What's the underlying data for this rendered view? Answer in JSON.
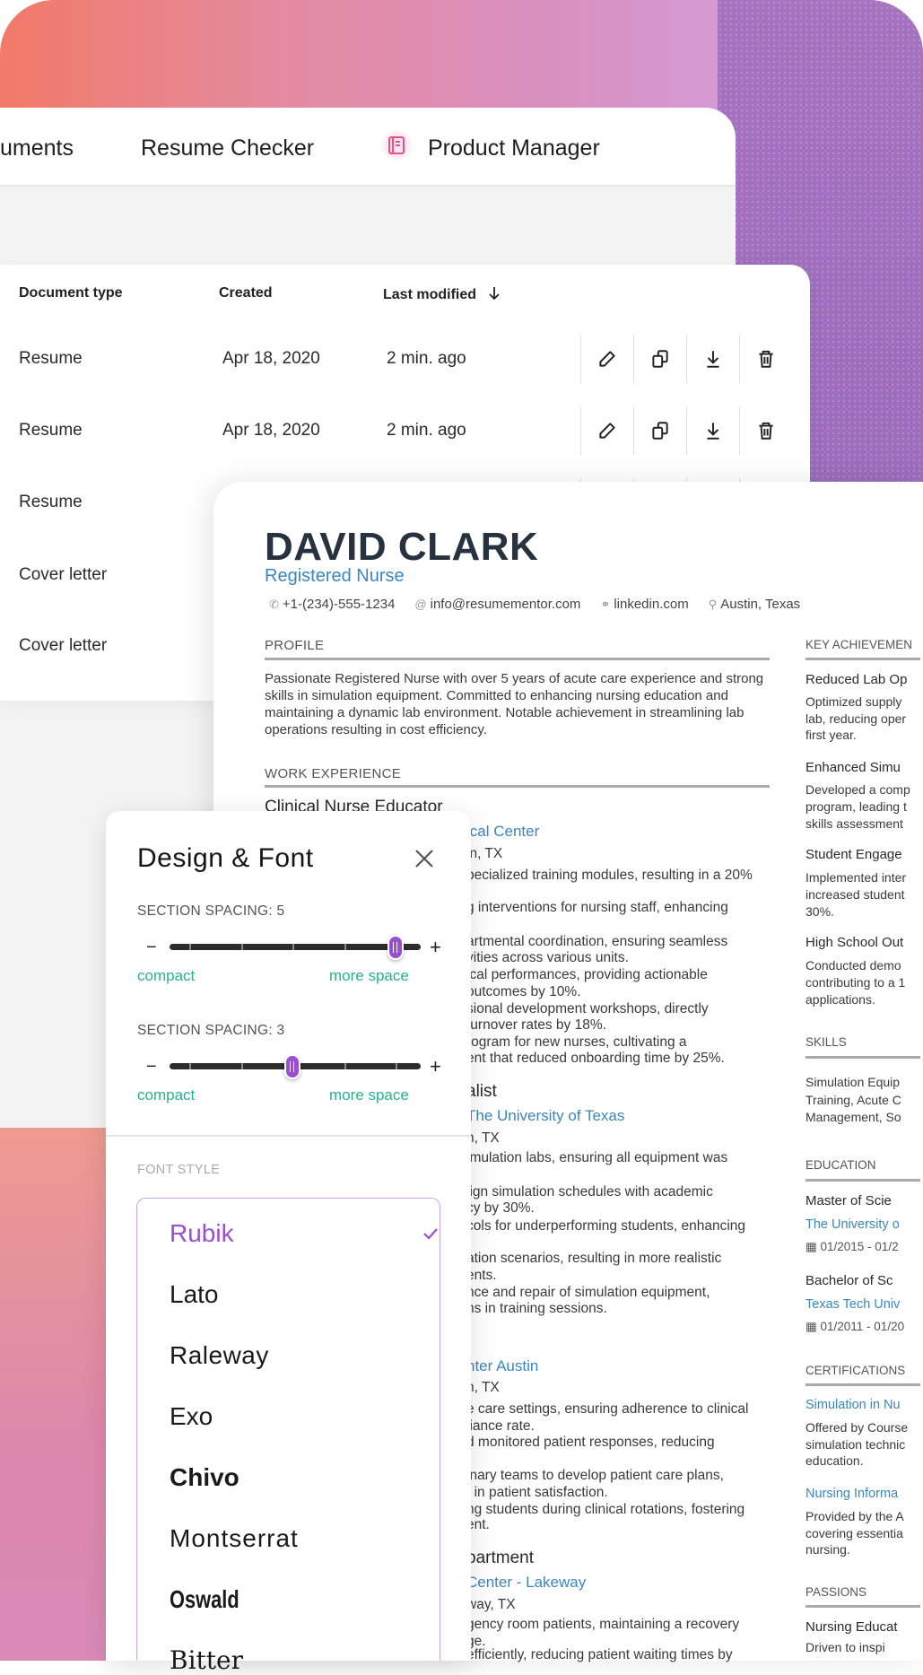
{
  "colors": {
    "accent_purple": "#9a4fcb",
    "teal": "#27b28f",
    "resume_blue": "#3a87c0",
    "name_dark": "#27323f"
  },
  "nav": {
    "items": [
      "uments",
      "Resume Checker",
      "Product Manager"
    ],
    "product_icon": "notebook-icon"
  },
  "table": {
    "headers": [
      "Document type",
      "Created",
      "Last modified"
    ],
    "sort_icon": "arrow-down-icon",
    "rows": [
      {
        "type": "Resume",
        "created": "Apr 18, 2020",
        "modified": "2 min. ago"
      },
      {
        "type": "Resume",
        "created": "Apr 18, 2020",
        "modified": "2 min. ago"
      },
      {
        "type": "Resume"
      },
      {
        "type": "Cover letter"
      },
      {
        "type": "Cover letter"
      }
    ],
    "actions": [
      "pencil-icon",
      "copy-icon",
      "download-icon",
      "trash-icon"
    ]
  },
  "resume": {
    "name": "DAVID CLARK",
    "role": "Registered Nurse",
    "contact": {
      "phone": "+1-(234)-555-1234",
      "email": "info@resumementor.com",
      "link": "linkedin.com",
      "location": "Austin, Texas"
    },
    "sections": {
      "profile": "PROFILE",
      "work": "WORK EXPERIENCE",
      "key": "KEY ACHIEVEMEN",
      "skills": "SKILLS",
      "education": "EDUCATION",
      "certifications": "CERTIFICATIONS",
      "passions": "PASSIONS"
    },
    "profile_text": "Passionate Registered Nurse with over 5 years of acute care experience and strong skills in simulation equipment. Committed to enhancing nursing education and maintaining a dynamic lab environment. Notable achievement in streamlining lab operations resulting in cost efficiency.",
    "first_job_title": "Clinical Nurse Educator",
    "work_lines": [
      {
        "t": "ical Center",
        "s": "company"
      },
      {
        "t": "in, TX"
      },
      {
        "t": "pecialized training modules, resulting in a 20%"
      },
      {
        "t": "."
      },
      {
        "t": "g interventions for nursing staff, enhancing"
      },
      {
        "t": "."
      },
      {
        "t": "artmental coordination, ensuring seamless"
      },
      {
        "t": "vities across various units."
      },
      {
        "t": "ical performances, providing actionable"
      },
      {
        "t": " outcomes by 10%."
      },
      {
        "t": "sional development workshops, directly"
      },
      {
        "t": " turnover rates by 18%."
      },
      {
        "t": "rogram for new nurses, cultivating a"
      },
      {
        "t": "ent that reduced onboarding time by 25%."
      },
      {
        "t": "alist",
        "s": "title"
      },
      {
        "t": " The University of Texas",
        "s": "company"
      },
      {
        "t": "n, TX"
      },
      {
        "t": "imulation labs, ensuring all equipment was"
      },
      {
        "t": "lign simulation schedules with academic"
      },
      {
        "t": "cy by 30%."
      },
      {
        "t": "cols for underperforming students, enhancing"
      },
      {
        "t": "ation scenarios, resulting in more realistic"
      },
      {
        "t": "ents."
      },
      {
        "t": "nce and repair of simulation equipment,"
      },
      {
        "t": "ns in training sessions."
      },
      {
        "t": "nter Austin",
        "s": "company"
      },
      {
        "t": "n, TX"
      },
      {
        "t": "e care settings, ensuring adherence to clinical"
      },
      {
        "t": "liance rate."
      },
      {
        "t": "d monitored patient responses, reducing"
      },
      {
        "t": "inary teams to develop patient care plans,"
      },
      {
        "t": "t in patient satisfaction."
      },
      {
        "t": "ng students during clinical rotations, fostering"
      },
      {
        "t": "ent."
      },
      {
        "t": "partment",
        "s": "title"
      },
      {
        "t": " Center - Lakeway",
        "s": "company"
      },
      {
        "t": "way, TX"
      },
      {
        "t": "gency room patients, maintaining a recovery"
      },
      {
        "t": "ge."
      },
      {
        "t": "efficiently, reducing patient waiting times by"
      }
    ],
    "right_lines": [
      {
        "t": "Reduced Lab Op",
        "s": "rtitle"
      },
      {
        "t": "Optimized supply"
      },
      {
        "t": "lab, reducing oper"
      },
      {
        "t": "first year."
      },
      {
        "t": "Enhanced Simu",
        "s": "rtitle"
      },
      {
        "t": "Developed a comp"
      },
      {
        "t": "program, leading t"
      },
      {
        "t": "skills assessment"
      },
      {
        "t": "Student Engage",
        "s": "rtitle"
      },
      {
        "t": "Implemented inter"
      },
      {
        "t": "increased student"
      },
      {
        "t": "30%."
      },
      {
        "t": "High School Out",
        "s": "rtitle"
      },
      {
        "t": "Conducted demo"
      },
      {
        "t": "contributing to a 1"
      },
      {
        "t": "applications."
      },
      {
        "t": "Simulation Equip"
      },
      {
        "t": "Training, Acute C"
      },
      {
        "t": "Management, So"
      },
      {
        "t": "Master of Scie",
        "s": "rtitle"
      },
      {
        "t": "The University o",
        "s": "company"
      },
      {
        "t": "▦ 01/2015 - 01/2",
        "s": "dates"
      },
      {
        "t": "Bachelor of Sc",
        "s": "rtitle"
      },
      {
        "t": "Texas Tech Univ",
        "s": "company"
      },
      {
        "t": "▦ 01/2011 - 01/20",
        "s": "dates"
      },
      {
        "t": "Simulation in Nu",
        "s": "company"
      },
      {
        "t": "Offered by Course"
      },
      {
        "t": "simulation technic"
      },
      {
        "t": "education."
      },
      {
        "t": "Nursing Informa",
        "s": "company"
      },
      {
        "t": "Provided by the A"
      },
      {
        "t": "covering essentia"
      },
      {
        "t": "nursing."
      },
      {
        "t": "Nursing Educat",
        "s": "rtitle"
      },
      {
        "t": "Driven to inspi"
      }
    ]
  },
  "panel": {
    "title": "Design & Font",
    "close_icon": "close-icon",
    "sliders": [
      {
        "label": "SECTION SPACING: 5",
        "value": 5,
        "min": 1,
        "max": 5,
        "low_label": "compact",
        "high_label": "more space"
      },
      {
        "label": "SECTION SPACING: 3",
        "value": 3,
        "min": 1,
        "max": 5,
        "low_label": "compact",
        "high_label": "more space"
      }
    ],
    "font_style_label": "FONT STYLE",
    "fonts": [
      {
        "name": "Rubik",
        "selected": true
      },
      {
        "name": "Lato"
      },
      {
        "name": "Raleway"
      },
      {
        "name": "Exo"
      },
      {
        "name": "Chivo"
      },
      {
        "name": "Montserrat"
      },
      {
        "name": "Oswald"
      },
      {
        "name": "Bitter"
      }
    ]
  }
}
